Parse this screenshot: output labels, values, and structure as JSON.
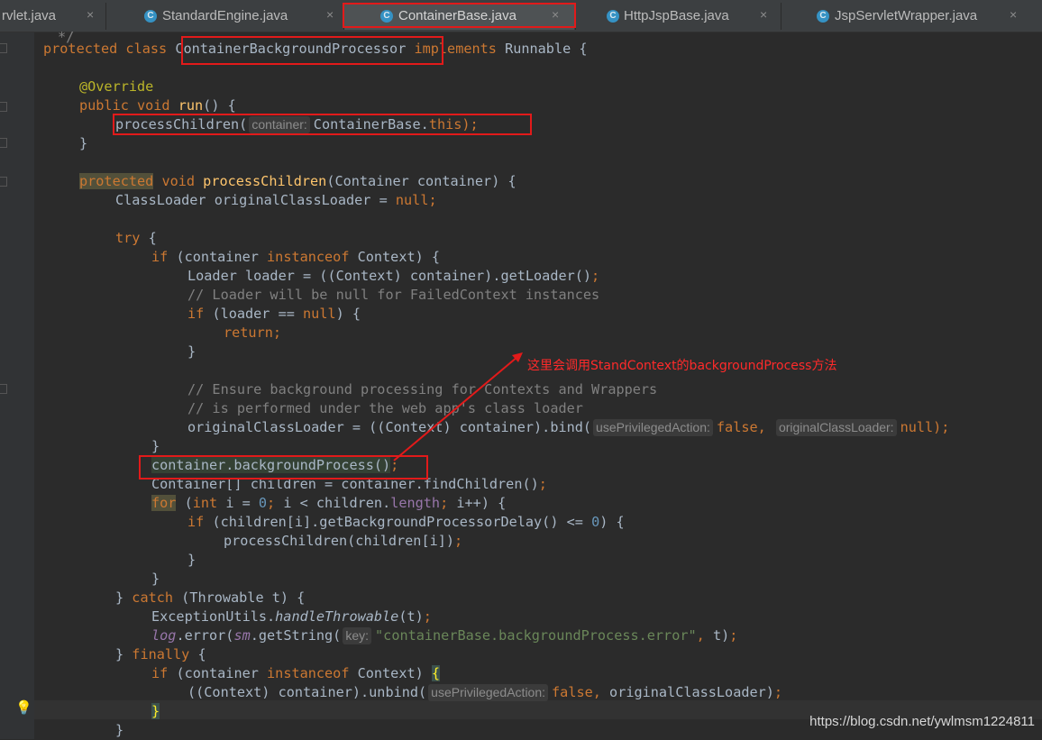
{
  "tabs": [
    {
      "label": "rvlet.java",
      "close": "×"
    },
    {
      "label": "StandardEngine.java",
      "close": "×",
      "icon": "C"
    },
    {
      "label": "ContainerBase.java",
      "close": "×",
      "icon": "C",
      "active": true
    },
    {
      "label": "HttpJspBase.java",
      "close": "×",
      "icon": "C"
    },
    {
      "label": "JspServletWrapper.java",
      "close": "×",
      "icon": "C"
    }
  ],
  "code": {
    "l0": "*/",
    "l1a": "protected class ",
    "l1b": "ContainerBackgroundProcessor",
    "l1c": " implements ",
    "l1d": "Runnable {",
    "l2": "@Override",
    "l3a": "public void ",
    "l3b": "run",
    "l3c": "() {",
    "l4a": "processChildren(",
    "l4hint": "container:",
    "l4b": "ContainerBase.",
    "l4c": "this",
    "l4d": ");",
    "l5": "}",
    "l6a": "protected",
    "l6b": " void ",
    "l6c": "processChildren",
    "l6d": "(Container container) {",
    "l7a": "ClassLoader originalClassLoader = ",
    "l7b": "null",
    "l7c": ";",
    "l8a": "try",
    "l8b": " {",
    "l9a": "if",
    "l9b": " (container ",
    "l9c": "instanceof",
    "l9d": " Context) {",
    "l10a": "Loader loader = ((Context) container).getLoader()",
    "l10b": ";",
    "l11": "// Loader will be null for FailedContext instances",
    "l12a": "if",
    "l12b": " (loader == ",
    "l12c": "null",
    "l12d": ") {",
    "l13": "return;",
    "l14": "}",
    "l15": "// Ensure background processing for Contexts and Wrappers",
    "l16": "// is performed under the web app's class loader",
    "l17a": "originalClassLoader = ((Context) container).bind(",
    "l17hint1": "usePrivilegedAction:",
    "l17b": "false",
    "l17c": ",",
    "l17hint2": "originalClassLoader:",
    "l17d": "null",
    "l17e": ");",
    "l18": "}",
    "l19a": "container.backgroundProcess()",
    "l19b": ";",
    "l20a": "Container[] children = container.findChildren()",
    "l20b": ";",
    "l21a": "for",
    "l21b": " (",
    "l21c": "int",
    "l21d": " i = ",
    "l21e": "0",
    "l21f": "; ",
    "l21g": "i < children.",
    "l21h": "length",
    "l21i": "; ",
    "l21j": "i++) {",
    "l22a": "if",
    "l22b": " (children[i].getBackgroundProcessorDelay() <= ",
    "l22c": "0",
    "l22d": ") {",
    "l23a": "processChildren(children[i])",
    "l23b": ";",
    "l24": "}",
    "l25": "}",
    "l26a": "} ",
    "l26b": "catch",
    "l26c": " (Throwable t) {",
    "l27a": "ExceptionUtils.",
    "l27b": "handleThrowable",
    "l27c": "(t)",
    "l27d": ";",
    "l28a": "log",
    "l28b": ".error(",
    "l28c": "sm",
    "l28d": ".getString(",
    "l28hint": "key:",
    "l28e": "\"containerBase.backgroundProcess.error\"",
    "l28f": ", ",
    "l28g": "t)",
    "l28h": ";",
    "l29a": "} ",
    "l29b": "finally",
    "l29c": " {",
    "l30a": "if",
    "l30b": " (container ",
    "l30c": "instanceof",
    "l30d": " Context) ",
    "l30e": "{",
    "l31a": "((Context) container).unbind(",
    "l31hint": "usePrivilegedAction:",
    "l31b": "false",
    "l31c": ", ",
    "l31d": "originalClassLoader)",
    "l31e": ";",
    "l32": "}",
    "l33": "}"
  },
  "annotation": {
    "text": "这里会调用StandContext的backgroundProcess方法",
    "color": "#e21a1a"
  },
  "watermark": "https://blog.csdn.net/ywlmsm1224811",
  "colors": {
    "background": "#2b2b2b",
    "keyword": "#cc7832",
    "method": "#ffc66d",
    "comment": "#808080",
    "number": "#6897bb",
    "string": "#6a8759",
    "annotation": "#bbb529"
  },
  "icons": [
    "class-icon",
    "close-icon",
    "lightbulb-icon"
  ]
}
